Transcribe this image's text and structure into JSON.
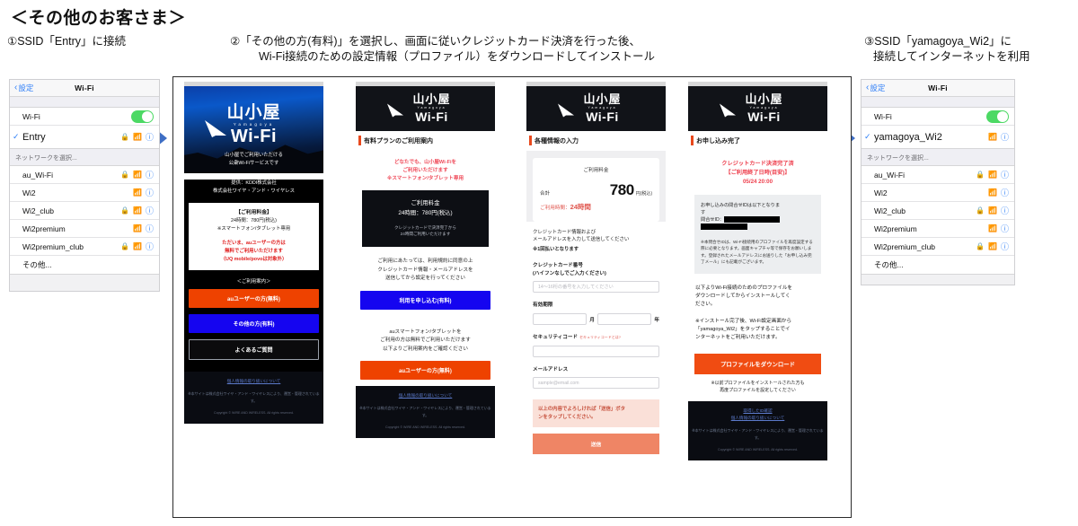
{
  "header": {
    "title": "＜その他のお客さま＞",
    "step1": "①SSID「Entry」に接続",
    "step2_line1": "②「その他の方(有料)」を選択し、画面に従いクレジットカード決済を行った後、",
    "step2_line2": "Wi-Fi接続のための設定情報（プロファイル）をダウンロードしてインストール",
    "step3_line1": "③SSID「yamagoya_Wi2」に",
    "step3_line2": "接続してインターネットを利用"
  },
  "ios_left": {
    "back_label": "設定",
    "nav_title": "Wi-Fi",
    "wifi_row_label": "Wi-Fi",
    "selected_network": "Entry",
    "section_header": "ネットワークを選択...",
    "networks": [
      {
        "name": "au_Wi-Fi",
        "lock": true
      },
      {
        "name": "Wi2",
        "lock": false
      },
      {
        "name": "Wi2_club",
        "lock": true
      },
      {
        "name": "Wi2premium",
        "lock": false
      },
      {
        "name": "Wi2premium_club",
        "lock": true
      },
      {
        "name": "その他...",
        "lock": false,
        "plain": true
      }
    ]
  },
  "ios_right": {
    "back_label": "設定",
    "nav_title": "Wi-Fi",
    "wifi_row_label": "Wi-Fi",
    "selected_network": "yamagoya_Wi2",
    "section_header": "ネットワークを選択...",
    "networks": [
      {
        "name": "au_Wi-Fi",
        "lock": true
      },
      {
        "name": "Wi2",
        "lock": false
      },
      {
        "name": "Wi2_club",
        "lock": true
      },
      {
        "name": "Wi2premium",
        "lock": false
      },
      {
        "name": "Wi2premium_club",
        "lock": true
      },
      {
        "name": "その他...",
        "lock": false,
        "plain": true
      }
    ]
  },
  "logo": {
    "kanji": "山小屋",
    "romaji": "Yamagoya",
    "wifi": "Wi-Fi"
  },
  "screen1": {
    "hero_sub_1": "山小屋でご利用いただける",
    "hero_sub_2": "公衆Wi-Fiサービスです",
    "hero_prov_1": "提供：KDDI株式会社",
    "hero_prov_2": "株式会社ワイヤ・アンド・ワイヤレス",
    "card_title": "【ご利用料金】",
    "card_line2": "24時間：780円(税込)",
    "card_line3": "※スマートフォン/タブレット専用",
    "card_red_1": "ただいま、auユーザーの方は",
    "card_red_2": "無料でご利用いただけます",
    "card_red_3": "（UQ mobile/povoは対象外）",
    "guide_label": "＜ご利用案内＞",
    "btn_au": "auユーザーの方(無料)",
    "btn_other": "その他の方(有料)",
    "btn_faq": "よくあるご質問",
    "foot_link": "個人情報の取り扱いについて",
    "foot_license": "※本サイトは株式会社ワイヤ・アンド・ワイヤレスにより、運営・管理されています。",
    "foot_copy": "Copyright © WIRE AND WIRELESS. All rights reserved."
  },
  "screen2": {
    "page_title": "有料プランのご利用案内",
    "red_1": "どなたでも、山小屋Wi-Fiを",
    "red_2": "ご利用いただけます",
    "red_3": "※スマートフォン/タブレット専用",
    "card_title": "ご利用料金",
    "card_price": "24時間：780円(税込)",
    "card_note_1": "クレジットカードで決済完了から",
    "card_note_2": "24時間ご利用いただけます",
    "note_1": "ご利用にあたっては、利用規約に同意の上",
    "note_2": "クレジットカード情報・メールアドレスを",
    "note_3": "送信してから設定を行ってください",
    "btn_apply": "利用を申し込む(有料)",
    "note2_1": "auスマートフォン/タブレットを",
    "note2_2": "ご利用の方は無料でご利用いただけます",
    "note2_3": "以下よりご利用案内をご確認ください",
    "btn_au": "auユーザーの方(無料)",
    "foot_link": "個人情報の取り扱いについて",
    "foot_license": "※本サイトは株式会社ワイヤ・アンド・ワイヤレスにより、運営・管理されています。",
    "foot_copy": "Copyright © WIRE AND WIRELESS. All rights reserved."
  },
  "screen3": {
    "page_title": "各種情報の入力",
    "price_title": "ご利用料金",
    "price_label": "合計",
    "price_amount": "780",
    "price_unit": "円(税込)",
    "price_duration_label": "ご利用時間：",
    "price_duration_value": "24時間",
    "form_desc_1": "クレジットカード情報および",
    "form_desc_2": "メールアドレスを入力して送信してください",
    "form_desc_3": "※1回払いとなります",
    "label_card_1": "クレジットカード番号",
    "label_card_2": "(ハイフンなしでご入力ください)",
    "placeholder_card": "14〜16桁の番号を入力してください",
    "label_expiry": "有効期限",
    "unit_month": "月",
    "unit_year": "年",
    "label_security": "セキュリティコード",
    "security_hint": "セキュリティコードとは?",
    "label_email": "メールアドレス",
    "placeholder_email": "sample@email.com",
    "confirm_1": "以上の内容でよろしければ「送信」ボタ",
    "confirm_2": "ンをタップしてください。",
    "btn_submit": "送信"
  },
  "screen4": {
    "page_title": "お申し込み完了",
    "red_1": "クレジットカード決済完了済",
    "red_2": "【ご利用終了日時(目安)】",
    "red_3": "05/24 20:00",
    "card_text_1": "お申し込みの問合せIDは以下となりま",
    "card_text_2": "す",
    "card_id_label": "問合せID：",
    "card_note": "※本問合せIDは、Wi-Fi接続用のプロファイルを再度設定する際に必要となります。画面キャプチャ等で保存をお願いします。登録されたメールアドレスにお送りした「お申し込み完了メール」にも記載がございます。",
    "text_1": "以下よりWi-Fi接続のためのプロファイルを",
    "text_2": "ダウンロードしてからインストールしてく",
    "text_3": "ださい。",
    "text2_1": "※インストール完了後、Wi-Fi設定画面から",
    "text2_2": "「yamagoya_Wi2」をタップすることでイ",
    "text2_3": "ンターネットをご利用いただけます。",
    "btn_download": "プロファイルをダウンロード",
    "small_1": "※以前プロファイルをインストールされた方も",
    "small_2": "再度プロファイルを設定してください",
    "foot_link_1": "取得したID確認",
    "foot_link_2": "個人情報の取り扱いについて",
    "foot_license": "※本サイトは株式会社ワイヤ・アンド・ワイヤレスにより、運営・管理されています。",
    "foot_copy": "Copyright © WIRE AND WIRELESS. All rights reserved."
  },
  "icons": {
    "lock": "🔒",
    "wifi": "📶",
    "info": "ⓘ",
    "check": "✓",
    "chevron_left": "‹"
  },
  "colors": {
    "accent_orange": "#ee4200",
    "accent_blue": "#1505f0",
    "red_text": "#e02020",
    "toggle_green": "#4cd964",
    "ios_blue": "#2d7ef7",
    "arrow_blue": "#3e6ec4"
  }
}
